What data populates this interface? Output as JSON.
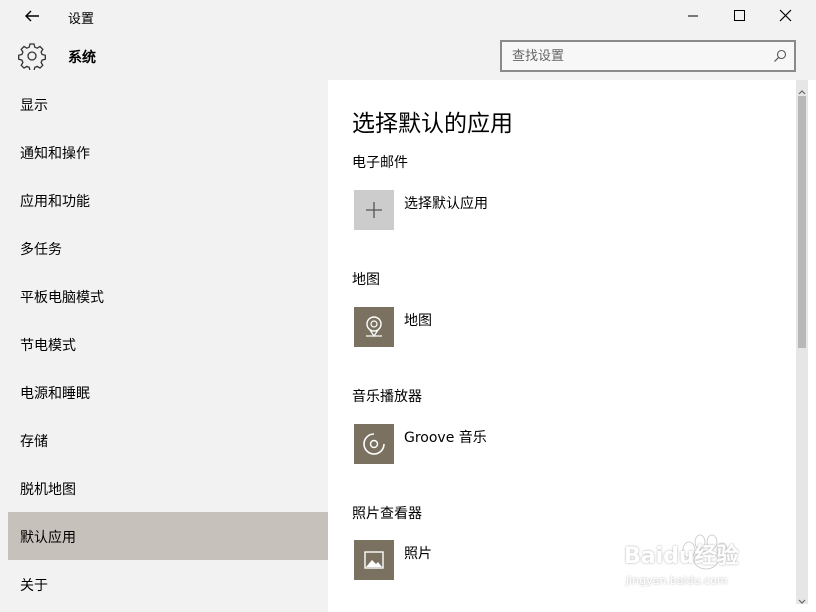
{
  "titlebar": {
    "title": "设置"
  },
  "header": {
    "title": "系统"
  },
  "search": {
    "placeholder": "查找设置"
  },
  "sidebar": {
    "items": [
      {
        "label": "显示"
      },
      {
        "label": "通知和操作"
      },
      {
        "label": "应用和功能"
      },
      {
        "label": "多任务"
      },
      {
        "label": "平板电脑模式"
      },
      {
        "label": "节电模式"
      },
      {
        "label": "电源和睡眠"
      },
      {
        "label": "存储"
      },
      {
        "label": "脱机地图"
      },
      {
        "label": "默认应用",
        "selected": true
      },
      {
        "label": "关于"
      }
    ]
  },
  "main": {
    "title": "选择默认的应用",
    "sections": [
      {
        "label": "电子邮件",
        "app": "选择默认应用",
        "icon": "plus-icon"
      },
      {
        "label": "地图",
        "app": "地图",
        "icon": "maps-icon"
      },
      {
        "label": "音乐播放器",
        "app": "Groove 音乐",
        "icon": "groove-music-icon"
      },
      {
        "label": "照片查看器",
        "app": "照片",
        "icon": "photos-icon"
      }
    ]
  },
  "watermark": {
    "brand": "Baidu经验",
    "url": "jingyan.baidu.com"
  },
  "colors": {
    "sidebar_bg": "#f2f2f2",
    "selected_bg": "#c6c1ba",
    "tile_bg": "#7a7161",
    "tile_empty": "#cccccc"
  }
}
